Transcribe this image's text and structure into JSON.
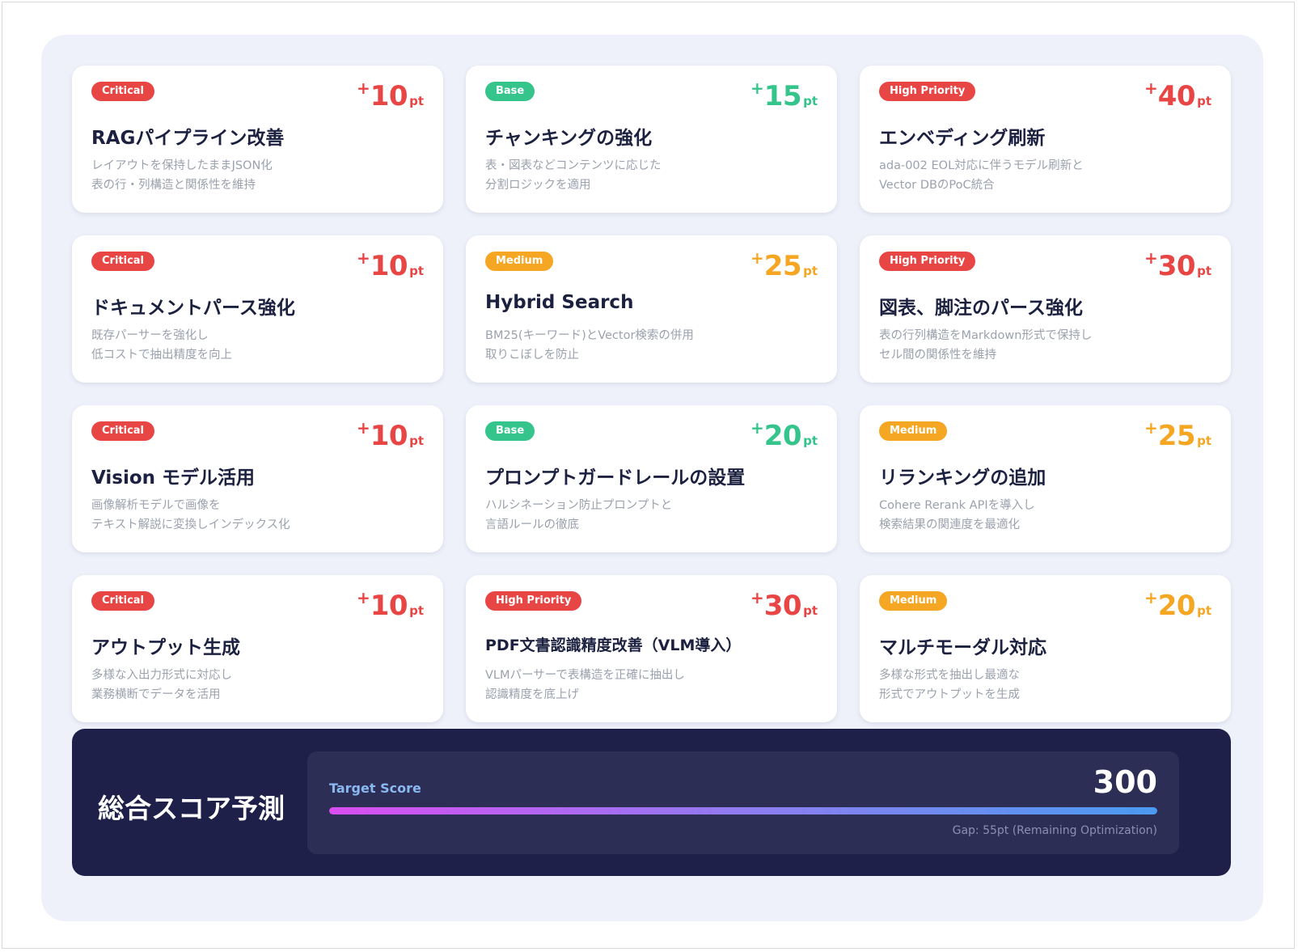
{
  "cards": [
    {
      "badge": "Critical",
      "badge_color": "#e84545",
      "sign": "+",
      "points": "10",
      "unit": "pt",
      "title": "RAGパイプライン改善",
      "desc1": "レイアウトを保持したままJSON化",
      "desc2": "表の行・列構造と関係性を維持"
    },
    {
      "badge": "Base",
      "badge_color": "#35c48b",
      "sign": "+",
      "points": "15",
      "unit": "pt",
      "title": "チャンキングの強化",
      "desc1": "表・図表などコンテンツに応じた",
      "desc2": "分割ロジックを適用"
    },
    {
      "badge": "High Priority",
      "badge_color": "#e84545",
      "sign": "+",
      "points": "40",
      "unit": "pt",
      "title": "エンベディング刷新",
      "desc1": "ada-002 EOL対応に伴うモデル刷新と",
      "desc2": "Vector DBのPoC統合"
    },
    {
      "badge": "Critical",
      "badge_color": "#e84545",
      "sign": "+",
      "points": "10",
      "unit": "pt",
      "title": "ドキュメントパース強化",
      "desc1": "既存パーサーを強化し",
      "desc2": "低コストで抽出精度を向上"
    },
    {
      "badge": "Medium",
      "badge_color": "#f5a623",
      "sign": "+",
      "points": "25",
      "unit": "pt",
      "title": "Hybrid Search",
      "desc1": "BM25(キーワード)とVector検索の併用",
      "desc2": "取りこぼしを防止"
    },
    {
      "badge": "High Priority",
      "badge_color": "#e84545",
      "sign": "+",
      "points": "30",
      "unit": "pt",
      "title": "図表、脚注のパース強化",
      "desc1": "表の行列構造をMarkdown形式で保持し",
      "desc2": "セル間の関係性を維持"
    },
    {
      "badge": "Critical",
      "badge_color": "#e84545",
      "sign": "+",
      "points": "10",
      "unit": "pt",
      "title": "Vision モデル活用",
      "desc1": "画像解析モデルで画像を",
      "desc2": "テキスト解説に変換しインデックス化"
    },
    {
      "badge": "Base",
      "badge_color": "#35c48b",
      "sign": "+",
      "points": "20",
      "unit": "pt",
      "title": "プロンプトガードレールの設置",
      "desc1": "ハルシネーション防止プロンプトと",
      "desc2": "言語ルールの徹底"
    },
    {
      "badge": "Medium",
      "badge_color": "#f5a623",
      "sign": "+",
      "points": "25",
      "unit": "pt",
      "title": "リランキングの追加",
      "desc1": "Cohere Rerank APIを導入し",
      "desc2": "検索結果の関連度を最適化"
    },
    {
      "badge": "Critical",
      "badge_color": "#e84545",
      "sign": "+",
      "points": "10",
      "unit": "pt",
      "title": "アウトプット生成",
      "desc1": "多様な入出力形式に対応し",
      "desc2": "業務横断でデータを活用"
    },
    {
      "badge": "High Priority",
      "badge_color": "#e84545",
      "sign": "+",
      "points": "30",
      "unit": "pt",
      "title": "PDF文書認識精度改善（VLM導入）",
      "desc1": "VLMパーサーで表構造を正確に抽出し",
      "desc2": "認識精度を底上げ"
    },
    {
      "badge": "Medium",
      "badge_color": "#f5a623",
      "sign": "+",
      "points": "20",
      "unit": "pt",
      "title": "マルチモーダル対応",
      "desc1": "多様な形式を抽出し最適な",
      "desc2": "形式でアウトプットを生成"
    }
  ],
  "summary": {
    "title": "総合スコア予測",
    "target_label": "Target Score",
    "target_value": "300",
    "progress_fraction": 1.0,
    "gap_text": "Gap: 55pt (Remaining Optimization)"
  },
  "colors": {
    "critical": "#e84545",
    "base": "#35c48b",
    "medium": "#f5a623",
    "summary_bg": "#1f2049",
    "panel_bg": "#eef1fa"
  }
}
